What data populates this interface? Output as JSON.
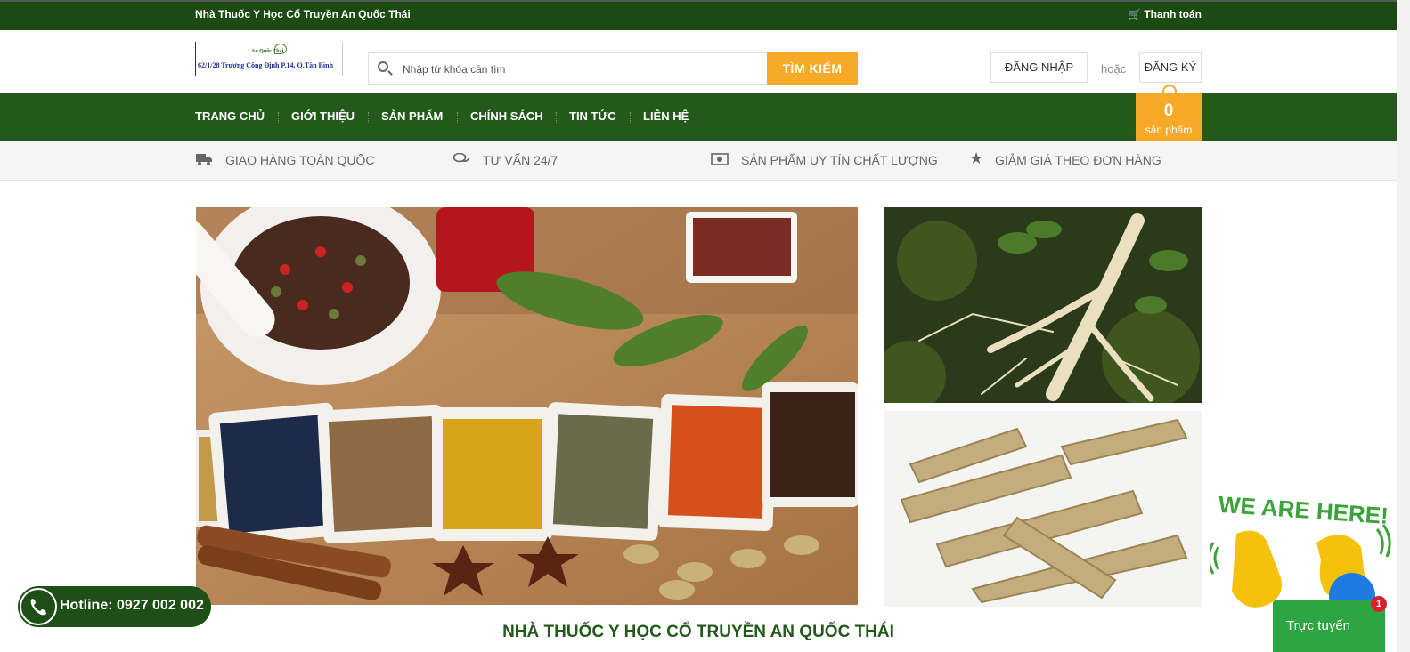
{
  "topbar": {
    "store_name": "Nhà Thuốc Y Học Cổ Truyền An Quốc Thái",
    "checkout_label": "Thanh toán",
    "checkout_icon": "cart-icon"
  },
  "logo": {
    "brand_text": "An Quốc Thái",
    "address_text": "62/1/28 Trương Công Định P.14, Q.Tân Bình"
  },
  "search": {
    "placeholder": "Nhập từ khóa cần tìm",
    "button_label": "TÌM KIẾM",
    "icon": "search-icon"
  },
  "account": {
    "login_label": "ĐĂNG NHẬP",
    "or_label": "hoặc",
    "register_label": "ĐĂNG KÝ"
  },
  "nav": {
    "items": [
      "TRANG CHỦ",
      "GIỚI THIỆU",
      "SẢN PHẨM",
      "CHÍNH SÁCH",
      "TIN TỨC",
      "LIÊN HỆ"
    ]
  },
  "cart": {
    "count": "0",
    "label": "sản phẩm"
  },
  "features": [
    {
      "label": "GIAO HÀNG TOÀN QUỐC",
      "icon": "truck-icon"
    },
    {
      "label": "TƯ VẤN 24/7",
      "icon": "chat-bubbles-icon"
    },
    {
      "label": "SẢN PHẨM UY TÍN CHẤT LƯỢNG",
      "icon": "money-icon"
    },
    {
      "label": "GIẢM GIÁ THEO ĐƠN HÀNG",
      "icon": "star-icon"
    }
  ],
  "main": {
    "heading": "NHÀ THUỐC Y HỌC CỔ TRUYỀN AN QUỐC THÁI"
  },
  "hotline": {
    "label": "Hotline: 0927 002 002",
    "icon": "phone-icon"
  },
  "chat_widget": {
    "greeting": "WE ARE HERE!",
    "button_label": "Trực tuyến",
    "badge_count": "1"
  },
  "colors": {
    "dark_green": "#1b4a12",
    "nav_green": "#235a1b",
    "accent_orange": "#f7a928",
    "chat_green": "#2ea543"
  }
}
